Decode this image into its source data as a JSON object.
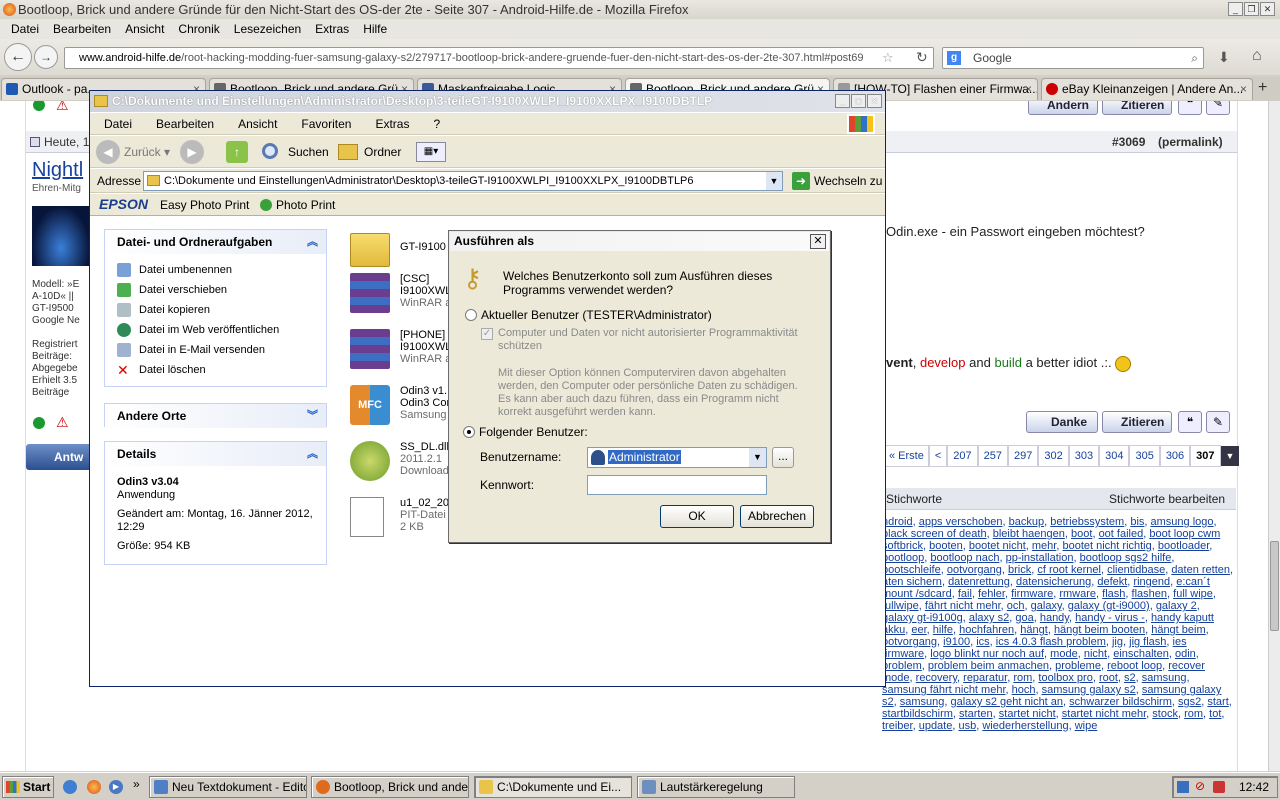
{
  "firefox": {
    "title": "Bootloop, Brick und andere Gründe für den Nicht-Start des OS-der 2te - Seite 307 - Android-Hilfe.de - Mozilla Firefox",
    "menu": [
      "Datei",
      "Bearbeiten",
      "Ansicht",
      "Chronik",
      "Lesezeichen",
      "Extras",
      "Hilfe"
    ],
    "url_host": "www.android-hilfe.de",
    "url_path": "/root-hacking-modding-fuer-samsung-galaxy-s2/279717-bootloop-brick-andere-gruende-fuer-den-nicht-start-des-os-der-2te-307.html#post69",
    "search_placeholder": "Google",
    "tabs": [
      {
        "label": "Outlook - pa...",
        "color": "#1e5ab4"
      },
      {
        "label": "Bootloop, Brick und andere Grü...",
        "color": "#555"
      },
      {
        "label": "Maskenfreigabe Logic ...",
        "color": "#3b5998"
      },
      {
        "label": "Bootloop, Brick und andere Grü...",
        "color": "#555"
      },
      {
        "label": "[HOW-TO] Flashen einer Firmwa...",
        "color": "#777"
      },
      {
        "label": "eBay Kleinanzeigen | Andere An...",
        "color": "#c00"
      }
    ]
  },
  "web": {
    "date": "Heute, 1",
    "username": "Nightl",
    "user_rank": "Ehren-Mitg",
    "user_info": [
      "Modell: »E",
      "A-10D« ||",
      "GT-I9500",
      "Google Ne",
      "",
      "Registriert",
      "Beiträge:",
      "Abgegebe",
      "Erhielt 3.5",
      "Beiträge"
    ],
    "post_number": "#3069",
    "permalink": "(permalink)",
    "post_text": "Odin.exe - ein Passwort eingeben möchtest?",
    "sig_prevent": "vent",
    "sig_develop": "develop",
    "sig_and1": "and",
    "sig_build": "build",
    "sig_rest": "a better idiot .:.",
    "btn_aendern": "Ändern",
    "btn_zitieren": "Zitieren",
    "btn_danke": "Danke",
    "btn_antworten": "Antw",
    "pagination": [
      "« Erste",
      "<",
      "207",
      "257",
      "297",
      "302",
      "303",
      "304",
      "305",
      "306",
      "307"
    ],
    "tags_title": "Stichworte",
    "tags_edit": "Stichworte bearbeiten",
    "tags": [
      "ndroid",
      "apps verschoben",
      "backup",
      "betriebssystem",
      "bis",
      "amsung logo",
      "black screen of death",
      "bleibt haengen",
      "boot",
      "oot failed",
      "boot loop cwm softbrick",
      "booten",
      "bootet nicht",
      "mehr",
      "bootet nicht richtig",
      "bootloader",
      "bootloop",
      "bootloop nach",
      "pp-installation",
      "bootloop sgs2 hilfe",
      "bootschleife",
      "ootvorgang",
      "brick",
      "cf root kernel",
      "clientidbase",
      "daten retten",
      "aten sichern",
      "datenrettung",
      "datensicherung",
      "defekt",
      "ringend",
      "e:can´t mount /sdcard",
      "fail",
      "fehler",
      "firmware",
      "rmware",
      "flash",
      "flashen",
      "full wipe",
      "fullwipe",
      "fährt nicht mehr",
      "och",
      "galaxy",
      "galaxy (gt-i9000)",
      "galaxy 2",
      "galaxy gt-i9100g",
      "alaxy s2",
      "goa",
      "handy",
      "handy - virus -",
      "handy kaputt akku",
      "eer",
      "hilfe",
      "hochfahren",
      "hängt",
      "hängt beim booten",
      "hängt beim",
      "ootvorgang",
      "i9100",
      "ics",
      "ics 4.0.3 flash problem",
      "jig",
      "jig flash",
      "ies firmware",
      "logo blinkt nur noch auf",
      "mode",
      "nicht",
      "einschalten",
      "odin",
      "problem",
      "problem beim anmachen",
      "probleme",
      "reboot loop",
      "recover mode",
      "recovery",
      "reparatur",
      "rom",
      "toolbox pro",
      "root",
      "s2",
      "samsung",
      "samsung fährt nicht mehr",
      "hoch",
      "samsung galaxy s2",
      "samsung galaxy s2",
      "samsung",
      "galaxy s2 geht nicht an",
      "schwarzer bildschirm",
      "sgs2",
      "start",
      "startbildschirm",
      "starten",
      "startet nicht",
      "startet nicht mehr",
      "stock",
      "rom",
      "tot",
      "treiber",
      "update",
      "usb",
      "wiederherstellung",
      "wipe"
    ]
  },
  "explorer": {
    "title": "C:\\Dokumente und Einstellungen\\Administrator\\Desktop\\3-teileGT-I9100XWLPI_I9100XXLPX_I9100DBTLP",
    "menu": [
      "Datei",
      "Bearbeiten",
      "Ansicht",
      "Favoriten",
      "Extras",
      "?"
    ],
    "back": "Zurück",
    "search": "Suchen",
    "folders": "Ordner",
    "address_label": "Adresse",
    "address": "C:\\Dokumente und Einstellungen\\Administrator\\Desktop\\3-teileGT-I9100XWLPI_I9100XXLPX_I9100DBTLP6",
    "go": "Wechseln zu",
    "epson": "EPSON",
    "easy_photo": "Easy Photo Print",
    "photo_print": "Photo Print",
    "tasks_title": "Datei- und Ordneraufgaben",
    "tasks": [
      "Datei umbenennen",
      "Datei verschieben",
      "Datei kopieren",
      "Datei im Web veröffentlichen",
      "Datei in E-Mail versenden",
      "Datei löschen"
    ],
    "other_places": "Andere Orte",
    "details_title": "Details",
    "details_name": "Odin3 v3.04",
    "details_type": "Anwendung",
    "details_changed": "Geändert am: Montag, 16. Jänner 2012, 12:29",
    "details_size": "Größe: 954 KB",
    "files": [
      {
        "name": "GT-I9100",
        "l2": "",
        "l3": ""
      },
      {
        "name": "[CSC]",
        "l2": "I9100XWL",
        "l3": "WinRAR a"
      },
      {
        "name": "[PHONE]",
        "l2": "I9100XWL",
        "l3": "WinRAR a"
      },
      {
        "name": "Odin3 v1.",
        "l2": "Odin3 Cor",
        "l3": "Samsung"
      },
      {
        "name": "SS_DL.dll",
        "l2": "2011.2.1",
        "l3": "Download"
      },
      {
        "name": "u1_02_20",
        "l2": "PIT-Datei",
        "l3": "2 KB"
      }
    ]
  },
  "dialog": {
    "title": "Ausführen als",
    "question": "Welches Benutzerkonto soll zum Ausführen dieses Programms verwendet werden?",
    "current_user": "Aktueller Benutzer (TESTER\\Administrator)",
    "protect": "Computer und Daten vor nicht autorisierter Programmaktivität schützen",
    "protect_info": "Mit dieser Option können Computerviren davon abgehalten werden, den Computer oder persönliche Daten zu schädigen. Es kann aber auch dazu führen, dass ein Programm nicht korrekt ausgeführt werden kann.",
    "following_user": "Folgender Benutzer:",
    "username_label": "Benutzername:",
    "username_value": "Administrator",
    "password_label": "Kennwort:",
    "password_value": "",
    "ok": "OK",
    "cancel": "Abbrechen",
    "browse": "..."
  },
  "taskbar": {
    "start": "Start",
    "items": [
      {
        "label": "Neu Textdokument - Editor",
        "color": "#4f7fc4"
      },
      {
        "label": "Bootloop, Brick und ande...",
        "color": "#e06a1b"
      },
      {
        "label": "C:\\Dokumente und Ei...",
        "color": "#e8c44a"
      },
      {
        "label": "Lautstärkeregelung",
        "color": "#6c8fbf"
      }
    ],
    "clock": "12:42"
  }
}
